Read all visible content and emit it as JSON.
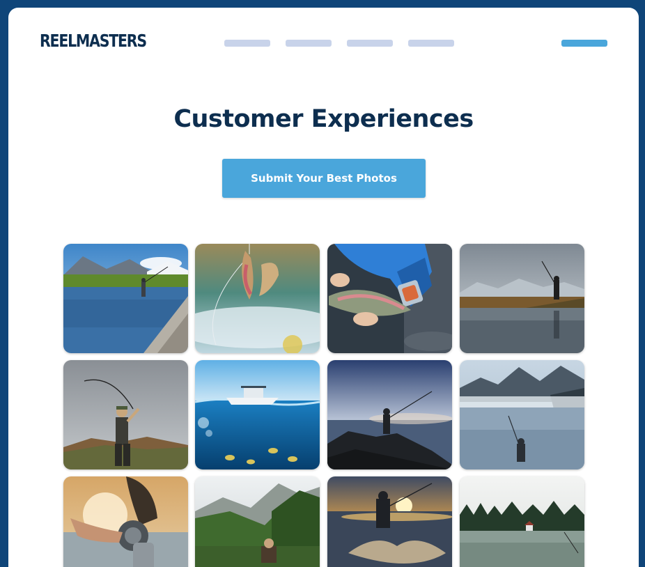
{
  "brand": {
    "name": "REELMASTERS"
  },
  "nav": {
    "links": [
      "",
      "",
      "",
      ""
    ],
    "cta": ""
  },
  "page": {
    "title": "Customer Experiences",
    "submit_label": "Submit Your Best Photos"
  },
  "colors": {
    "page_background": "#0f4579",
    "brand_navy": "#0d2e4f",
    "accent": "#4aa6db",
    "nav_placeholder": "#c8d3ea"
  },
  "gallery": {
    "photos": [
      {
        "subject": "angler wading a rocky river below mountains",
        "icon": "photo-river-mountains"
      },
      {
        "subject": "trout jumping on a fishing line",
        "icon": "photo-trout-jumping"
      },
      {
        "subject": "hands holding a rainbow trout",
        "icon": "photo-trout-in-hands"
      },
      {
        "subject": "angler casting from a grassy lakeshore",
        "icon": "photo-lakeshore-cast"
      },
      {
        "subject": "angler with bent rod by the shore",
        "icon": "photo-bent-rod"
      },
      {
        "subject": "fishing boat with fish underwater",
        "icon": "photo-boat-underwater"
      },
      {
        "subject": "silhouette casting from rocks at dusk",
        "icon": "photo-rocks-dusk"
      },
      {
        "subject": "angler on a misty mountain lake",
        "icon": "photo-misty-lake"
      },
      {
        "subject": "hand working a fly reel",
        "icon": "photo-fly-reel"
      },
      {
        "subject": "angler in a green mountain valley",
        "icon": "photo-mountain-valley"
      },
      {
        "subject": "angler wading at sunset with splashes",
        "icon": "photo-sunset-splash"
      },
      {
        "subject": "forested lake with a small cabin",
        "icon": "photo-forest-lake"
      }
    ]
  }
}
